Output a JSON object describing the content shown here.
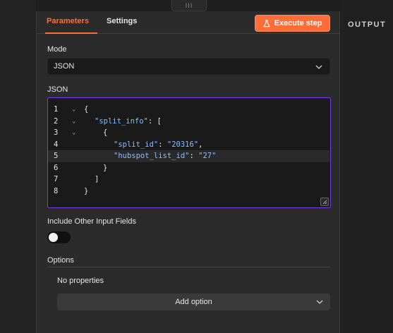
{
  "drag_handle": "III",
  "tabs": [
    {
      "label": "Parameters",
      "active": true
    },
    {
      "label": "Settings",
      "active": false
    }
  ],
  "execute_button": {
    "label": "Execute step",
    "icon": "flask-icon"
  },
  "mode": {
    "label": "Mode",
    "value": "JSON"
  },
  "json": {
    "label": "JSON",
    "lines": [
      {
        "num": "1",
        "fold": true
      },
      {
        "num": "2",
        "fold": true
      },
      {
        "num": "3",
        "fold": true
      },
      {
        "num": "4",
        "fold": false
      },
      {
        "num": "5",
        "fold": false,
        "active": true
      },
      {
        "num": "6",
        "fold": false
      },
      {
        "num": "7",
        "fold": false
      },
      {
        "num": "8",
        "fold": false
      }
    ],
    "code": {
      "l1": "{",
      "l2_key": "\"split_info\"",
      "l2_rest": ": [",
      "l3": "{",
      "l4_key": "\"split_id\"",
      "l4_sep": ": ",
      "l4_val": "\"20316\"",
      "l4_end": ",",
      "l5_key": "\"hubspot_list_id\"",
      "l5_sep": ": ",
      "l5_val": "\"27\"",
      "l6": "}",
      "l7": "]",
      "l8": "}"
    }
  },
  "include_other": {
    "label": "Include Other Input Fields",
    "enabled": false
  },
  "options": {
    "label": "Options",
    "empty_text": "No properties",
    "add_label": "Add option"
  },
  "output": {
    "label": "OUTPUT"
  },
  "colors": {
    "accent": "#ff6d3b",
    "editor_border": "#7c3aed"
  }
}
